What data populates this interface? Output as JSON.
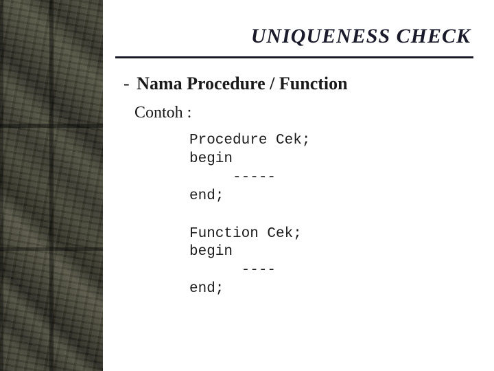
{
  "title": "UNIQUENESS CHECK",
  "subheading": "Nama Procedure / Function",
  "example_label": "Contoh :",
  "code_block_1": "Procedure Cek;\nbegin\n     -----\nend;",
  "code_block_2": "Function Cek;\nbegin\n      ----\nend;"
}
